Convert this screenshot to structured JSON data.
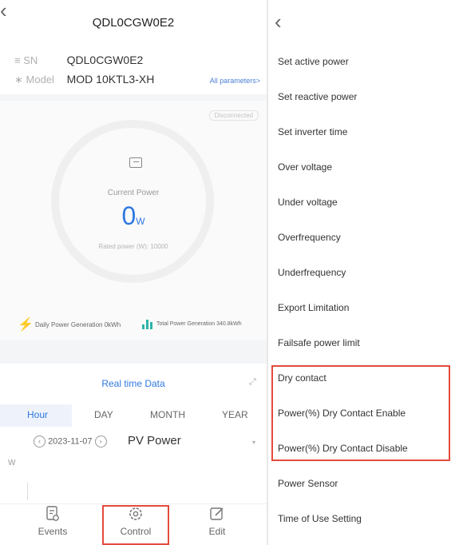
{
  "device": {
    "title": "QDL0CGW0E2",
    "sn_label": "SN",
    "sn_value": "QDL0CGW0E2",
    "model_label": "Model",
    "model_value": "MOD 10KTL3-XH",
    "all_params": "All parameters>",
    "status": "Disconnected"
  },
  "power": {
    "label": "Current Power",
    "value": "0",
    "unit": "W",
    "rated": "Rated power (W): 10000"
  },
  "generation": {
    "daily": "Daily Power Generation 0kWh",
    "total": "Total Power Generation 340.8kWh"
  },
  "realtime": {
    "title": "Real time Data",
    "tabs": [
      "Hour",
      "DAY",
      "MONTH",
      "YEAR"
    ],
    "active_tab": "Hour",
    "date": "2023-11-07",
    "metric": "PV Power",
    "unit": "W"
  },
  "bottom_nav": [
    {
      "label": "Events",
      "icon": "events-icon"
    },
    {
      "label": "Control",
      "icon": "gear-icon"
    },
    {
      "label": "Edit",
      "icon": "edit-icon"
    }
  ],
  "menu": [
    "Set active power",
    "Set reactive power",
    "Set inverter time",
    "Over voltage",
    "Under voltage",
    "Overfrequency",
    "Underfrequency",
    "Export Limitation",
    "Failsafe power limit",
    "Dry contact",
    "Power(%) Dry Contact Enable",
    "Power(%) Dry Contact Disable",
    "Power Sensor",
    "Time of Use Setting"
  ],
  "colors": {
    "accent": "#2f78e0",
    "highlight_box": "#e44b3c",
    "generation_icon": "#2bb5a8"
  }
}
